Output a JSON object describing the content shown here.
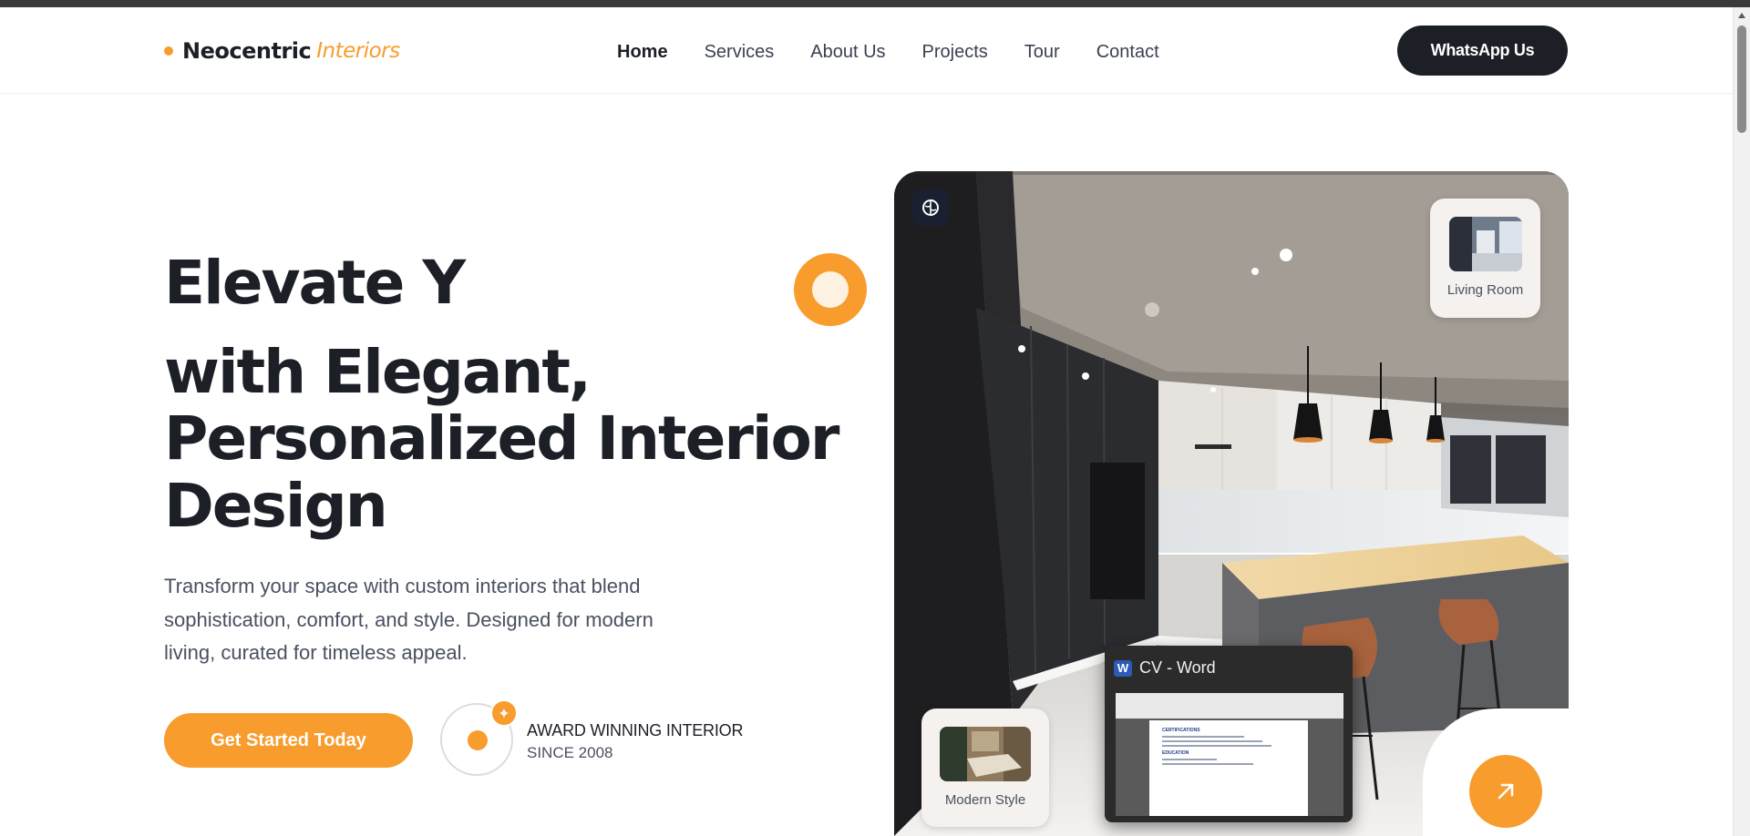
{
  "brand": {
    "name": "Neocentric",
    "accent": "Interiors",
    "accent_color": "#f89c2d",
    "dark_color": "#1c1f26"
  },
  "nav": {
    "items": [
      {
        "label": "Home",
        "active": true
      },
      {
        "label": "Services"
      },
      {
        "label": "About Us"
      },
      {
        "label": "Projects"
      },
      {
        "label": "Tour"
      },
      {
        "label": "Contact"
      }
    ],
    "cta_label": "WhatsApp Us"
  },
  "hero": {
    "title_line1": "Elevate Y",
    "title_line2": "with Elegant,",
    "title_line3": "Personalized Interior",
    "title_line4": "Design",
    "description": "Transform your space with custom interiors that blend sophistication, comfort, and style. Designed for modern living, curated for timeless appeal.",
    "cta_label": "Get Started Today",
    "award_title": "AWARD WINNING INTERIOR",
    "award_subtitle": "SINCE 2008"
  },
  "showcase": {
    "badge_icon": "brain-icon",
    "cards": [
      {
        "label": "Living Room"
      },
      {
        "label": "Modern Style"
      }
    ],
    "arrow_icon": "arrow-up-right-icon"
  },
  "taskbar_preview": {
    "app_icon": "word-icon",
    "app_letter": "W",
    "title": "CV - Word",
    "doc_heading1": "CERTIFICATIONS",
    "doc_heading2": "EDUCATION"
  }
}
